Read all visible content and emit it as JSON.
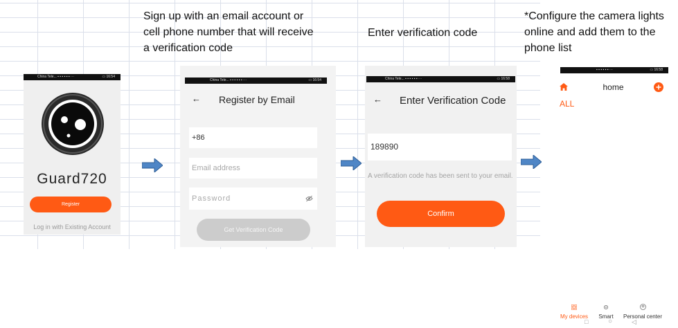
{
  "captions": {
    "step2": "Sign up with an email account or\ncell phone number that will receive\na verification code",
    "step3": "Enter verification code",
    "step4": "*Configure the camera lights\nonline and add them to the\nphone list"
  },
  "screen1": {
    "status_left": "China Tele... ▪ ▪ ▪ ▪ ▪ ▪ ···",
    "status_right": "▭ 16:54",
    "app_name": "Guard720",
    "register_label": "Register",
    "login_label": "Log in with Existing Account"
  },
  "screen2": {
    "status_left": "China Tele... ▪ ▪ ▪ ▪ ▪ ▪ ···",
    "status_right": "▭ 16:54",
    "back": "←",
    "title": "Register by Email",
    "phone_code": "+86",
    "email_placeholder": "Email address",
    "password_placeholder": "Password",
    "get_code_label": "Get Verification Code"
  },
  "screen3": {
    "status_left": "China Tele... ▪ ▪ ▪ ▪ ▪ ▪ ···",
    "status_right": "▭ 16:58",
    "back": "←",
    "title": "Enter Verification Code",
    "code_value": "189890",
    "hint": "A verification code has been sent to your email.",
    "confirm_label": "Confirm"
  },
  "screen4": {
    "status_left": "▪ ▪ ▪ ▪ ▪ ▪ ···",
    "status_right": "▭ 16:58",
    "title": "home",
    "filter_all": "ALL",
    "nav_devices": "My devices",
    "nav_smart": "Smart",
    "nav_personal": "Personal center",
    "sys_square": "□",
    "sys_circle": "○",
    "sys_back": "◁"
  },
  "colors": {
    "accent": "#ff5a14",
    "arrow": "#4f86c6",
    "disabled": "#cccccc"
  }
}
